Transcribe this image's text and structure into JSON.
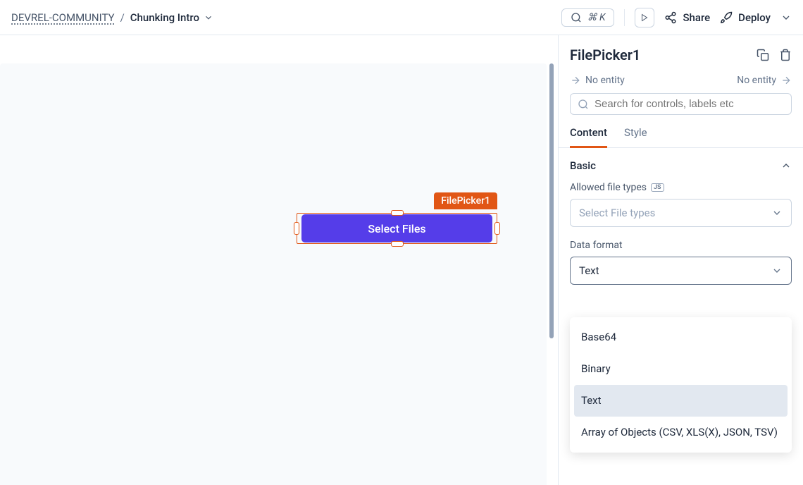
{
  "header": {
    "workspace": "DEVREL-COMMUNITY",
    "breadcrumb_sep": "/",
    "page": "Chunking Intro",
    "search_shortcut": "⌘ K",
    "share": "Share",
    "deploy": "Deploy"
  },
  "canvas": {
    "widget_tag": "FilePicker1",
    "button_label": "Select Files"
  },
  "panel": {
    "title": "FilePicker1",
    "entity_prev": "No entity",
    "entity_next": "No entity",
    "search_placeholder": "Search for controls, labels etc",
    "tabs": {
      "content": "Content",
      "style": "Style"
    },
    "sections": {
      "basic": "Basic"
    },
    "fields": {
      "allowed_label": "Allowed file types",
      "allowed_placeholder": "Select File types",
      "format_label": "Data format",
      "format_value": "Text"
    },
    "dropdown": {
      "opt1": "Base64",
      "opt2": "Binary",
      "opt3": "Text",
      "opt4": "Array of Objects (CSV, XLS(X), JSON, TSV)"
    }
  }
}
